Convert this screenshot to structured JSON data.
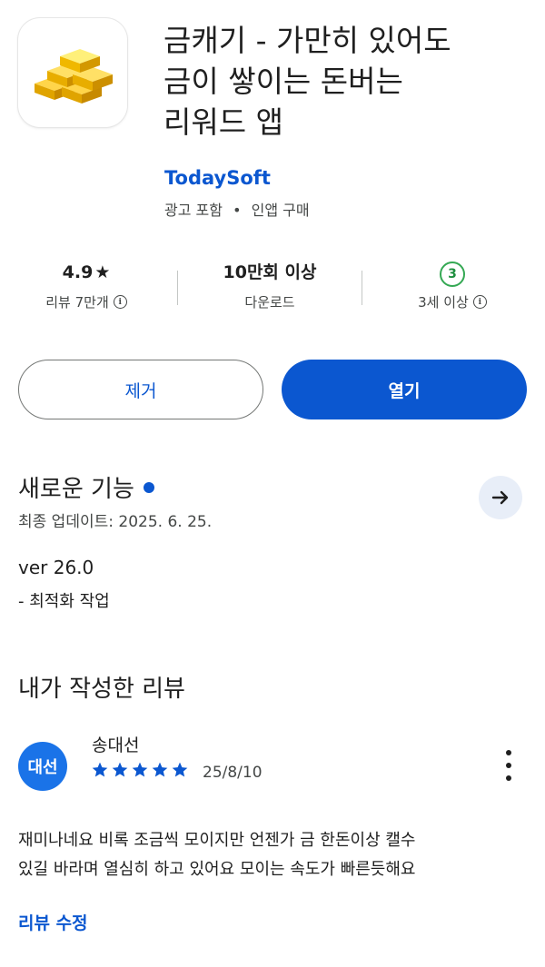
{
  "app": {
    "title_lines": [
      "금캐기 - 가만히 있어도",
      "금이 쌓이는 돈버는",
      "리워드 앱"
    ],
    "developer": "TodaySoft",
    "meta_ads": "광고 포함",
    "meta_separator": "•",
    "meta_iap": "인앱 구매",
    "icon": "gold-bars-icon"
  },
  "stats": {
    "rating": {
      "value": "4.9",
      "star": "★",
      "label": "리뷰 7만개"
    },
    "downloads": {
      "value": "10만회 이상",
      "label": "다운로드"
    },
    "age": {
      "badge": "3",
      "label": "3세 이상"
    }
  },
  "buttons": {
    "remove": "제거",
    "open": "열기"
  },
  "whats_new": {
    "title": "새로운 기능",
    "updated": "최종 업데이트: 2025. 6. 25.",
    "version": "ver 26.0",
    "notes": "- 최적화 작업"
  },
  "my_review": {
    "title": "내가 작성한 리뷰",
    "avatar_text": "대선",
    "reviewer": "송대선",
    "stars": 5,
    "date": "25/8/10",
    "text_lines": [
      "재미나네요 비록 조금씩 모이지만 언젠가 금 한돈이상 캘수",
      "있길 바라며 열심히 하고 있어요 모이는 속도가 빠른듯해요"
    ],
    "edit_label": "리뷰 수정"
  },
  "colors": {
    "accent": "#0b57d0",
    "age_green": "#34a853",
    "avatar_blue": "#1a73e8",
    "gold": "#f5b700"
  }
}
